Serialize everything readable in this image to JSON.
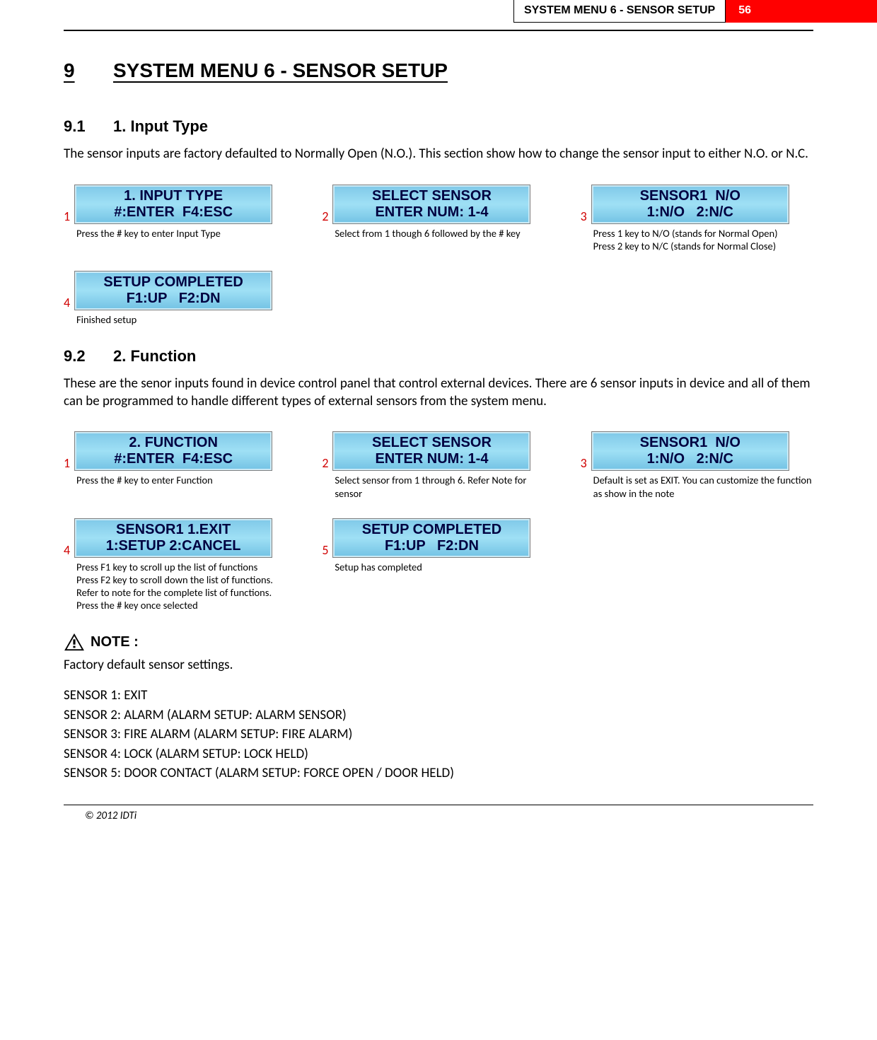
{
  "header": {
    "title": "SYSTEM MENU 6 - SENSOR SETUP",
    "page": "56"
  },
  "section": {
    "num": "9",
    "title": "SYSTEM MENU 6 - SENSOR SETUP"
  },
  "sub1": {
    "num": "9.1",
    "title": "1. Input Type",
    "para": "The sensor inputs are factory defaulted to Normally Open (N.O.). This section show how to change the sensor input to either N.O. or N.C.",
    "steps": [
      {
        "n": "1",
        "line1": "1. INPUT TYPE",
        "line2": "#:ENTER  F4:ESC",
        "caption": "Press the # key to enter Input Type"
      },
      {
        "n": "2",
        "line1": "SELECT SENSOR",
        "line2": "ENTER NUM: 1-4",
        "caption": "Select from 1 though 6  followed by the # key"
      },
      {
        "n": "3",
        "line1": "SENSOR1  N/O",
        "line2": "1:N/O   2:N/C",
        "caption": "Press 1 key to N/O (stands for Normal Open)\nPress 2 key to N/C (stands for Normal Close)"
      },
      {
        "n": "4",
        "line1": "SETUP COMPLETED",
        "line2": "F1:UP   F2:DN",
        "caption": "Finished setup"
      }
    ]
  },
  "sub2": {
    "num": "9.2",
    "title": "2. Function",
    "para": "These are the senor inputs found in device control panel that control external devices. There are 6 sensor inputs in device and all of them can be programmed to handle different types of external sensors from the system menu.",
    "steps": [
      {
        "n": "1",
        "line1": "2. FUNCTION",
        "line2": "#:ENTER  F4:ESC",
        "caption": "Press the # key to enter Function"
      },
      {
        "n": "2",
        "line1": "SELECT SENSOR",
        "line2": "ENTER NUM: 1-4",
        "caption": "Select sensor from 1 through 6. Refer Note for sensor"
      },
      {
        "n": "3",
        "line1": "SENSOR1  N/O",
        "line2": "1:N/O   2:N/C",
        "caption": "Default is set as EXIT. You can customize the function as show in the note"
      },
      {
        "n": "4",
        "line1": "SENSOR1 1.EXIT",
        "line2": "1:SETUP 2:CANCEL",
        "caption": "Press F1 key to scroll up the list of functions\nPress F2 key to scroll down the list of functions.\nRefer to note for the complete list of functions.\nPress the # key once selected"
      },
      {
        "n": "5",
        "line1": "SETUP COMPLETED",
        "line2": "F1:UP   F2:DN",
        "caption": "Setup has completed"
      }
    ]
  },
  "note": {
    "label": "NOTE :",
    "intro": "Factory default sensor settings.",
    "items": [
      "SENSOR 1: EXIT",
      "SENSOR 2: ALARM (ALARM SETUP: ALARM SENSOR)",
      "SENSOR 3: FIRE ALARM (ALARM SETUP: FIRE ALARM)",
      "SENSOR 4: LOCK (ALARM SETUP: LOCK HELD)",
      "SENSOR 5: DOOR CONTACT (ALARM SETUP: FORCE OPEN / DOOR HELD)"
    ]
  },
  "footer": "© 2012 IDTi"
}
